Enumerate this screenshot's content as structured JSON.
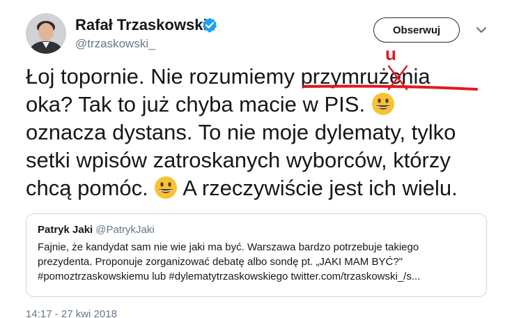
{
  "author": {
    "name": "Rafał Trzaskowski",
    "handle": "@trzaskowski_",
    "verified": true
  },
  "actions": {
    "follow_label": "Obserwuj"
  },
  "icons": {
    "verified": "verified-badge-icon",
    "menu": "chevron-down-icon",
    "emoji": "grinning-face-emoji"
  },
  "tweet": {
    "line1_a": "Łoj topornie. Nie rozumiemy ",
    "line1_b": "przymrużenia",
    "line2_a": "oka? Tak to już chyba macie w PIS. ",
    "line3": "oznacza dystans. To nie moje dylematy, tylko",
    "line4": "setki wpisów zatroskanych wyborców, którzy",
    "line5_a": "chcą pomóc. ",
    "line5_b": " A rzeczywiście jest ich wielu."
  },
  "correction": {
    "letter": "u",
    "color": "#e0191f"
  },
  "quoted_tweet": {
    "author_name": "Patryk Jaki",
    "author_handle": "@PatrykJaki",
    "line1": "Fajnie, że kandydat sam nie wie jaki ma być. Warszawa bardzo potrzebuje takiego",
    "line2": "prezydenta. Proponuje zorganizować debatę albo sondę pt. „JAKI MAM BYĆ?\"",
    "line3": "#pomoztrzaskowskiemu lub #dylematytrzaskowskiego twitter.com/trzaskowski_/s..."
  },
  "meta": {
    "timestamp": "14:17 - 27 kwi 2018"
  },
  "colors": {
    "verified_blue": "#1da1f2",
    "text": "#14171a",
    "secondary": "#657786",
    "border": "#ccd6dd",
    "emoji_yellow": "#f7c234"
  }
}
